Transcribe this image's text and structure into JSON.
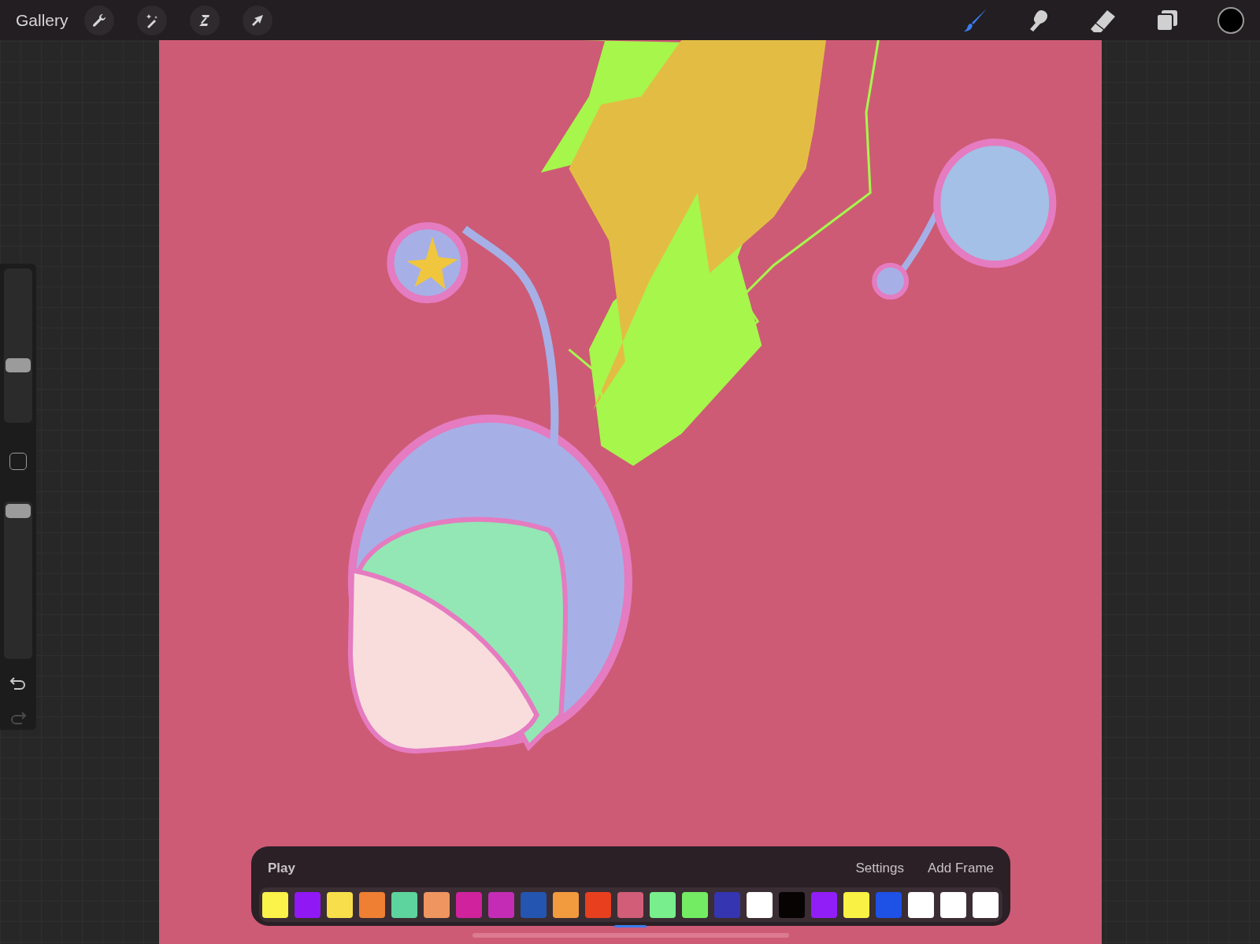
{
  "top_bar": {
    "gallery": "Gallery",
    "left_tools": [
      {
        "kind": "wrench"
      },
      {
        "kind": "wand"
      },
      {
        "kind": "selection"
      },
      {
        "kind": "arrow"
      }
    ],
    "right_tools": [
      {
        "kind": "brush",
        "selected": true
      },
      {
        "kind": "smudge",
        "selected": false
      },
      {
        "kind": "eraser",
        "selected": false
      },
      {
        "kind": "layers",
        "selected": false
      }
    ]
  },
  "sidebar": {
    "size_slider": {
      "level": 0.37
    },
    "opacity_slider": {
      "level": 0.94
    }
  },
  "timeline": {
    "play": "Play",
    "settings": "Settings",
    "add_frame": "Add Frame",
    "frames": [
      {
        "color": "#fbf24a",
        "selected": false
      },
      {
        "color": "#9018f5",
        "selected": false
      },
      {
        "color": "#f8de4a",
        "selected": false
      },
      {
        "color": "#ee7f33",
        "selected": false
      },
      {
        "color": "#5dd49d",
        "selected": false
      },
      {
        "color": "#ef9560",
        "selected": false
      },
      {
        "color": "#d0229d",
        "selected": false
      },
      {
        "color": "#c42cb6",
        "selected": false
      },
      {
        "color": "#2455b0",
        "selected": false
      },
      {
        "color": "#f29a3e",
        "selected": false
      },
      {
        "color": "#e8401f",
        "selected": false
      },
      {
        "color": "#d15d78",
        "selected": true
      },
      {
        "color": "#79ee8c",
        "selected": false
      },
      {
        "color": "#73ec63",
        "selected": false
      },
      {
        "color": "#3535b2",
        "selected": false
      },
      {
        "color": "#ffffff",
        "selected": false
      },
      {
        "color": "#070303",
        "selected": false
      },
      {
        "color": "#921ef7",
        "selected": false
      },
      {
        "color": "#faf145",
        "selected": false
      },
      {
        "color": "#1e51e6",
        "selected": false
      },
      {
        "color": "#ffffff",
        "selected": false
      },
      {
        "color": "#ffffff",
        "selected": false
      },
      {
        "color": "#ffffff",
        "selected": false
      }
    ]
  }
}
